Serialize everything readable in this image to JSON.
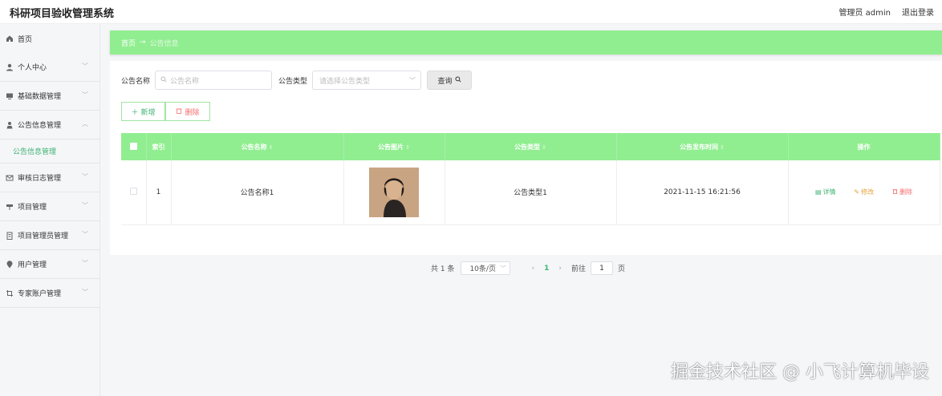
{
  "app": {
    "title": "科研项目验收管理系统"
  },
  "header": {
    "user": "管理员 admin",
    "logout": "退出登录"
  },
  "sidebar": {
    "items": [
      {
        "label": "首页",
        "icon": "home-icon"
      },
      {
        "label": "个人中心",
        "icon": "user-icon"
      },
      {
        "label": "基础数据管理",
        "icon": "monitor-icon"
      },
      {
        "label": "公告信息管理",
        "icon": "person-icon",
        "expanded": true,
        "children": [
          {
            "label": "公告信息管理"
          }
        ]
      },
      {
        "label": "审核日志管理",
        "icon": "message-icon"
      },
      {
        "label": "项目管理",
        "icon": "briefcase-icon"
      },
      {
        "label": "项目管理员管理",
        "icon": "office-icon"
      },
      {
        "label": "用户管理",
        "icon": "location-icon"
      },
      {
        "label": "专家账户管理",
        "icon": "crop-icon"
      }
    ]
  },
  "breadcrumb": {
    "home": "首页",
    "arrow": "→",
    "current": "公告信息"
  },
  "search": {
    "name_label": "公告名称",
    "name_placeholder": "公告名称",
    "type_label": "公告类型",
    "type_placeholder": "请选择公告类型",
    "query_button": "查询"
  },
  "actions": {
    "add": "新增",
    "delete": "删除"
  },
  "table": {
    "headers": [
      "索引",
      "公告名称",
      "公告图片",
      "公告类型",
      "公告发布时间",
      "操作"
    ],
    "rows": [
      {
        "index": "1",
        "name": "公告名称1",
        "type": "公告类型1",
        "time": "2021-11-15 16:21:56"
      }
    ],
    "ops": {
      "detail": "详情",
      "edit": "修改",
      "remove": "删除"
    }
  },
  "pagination": {
    "total": "共 1 条",
    "page_size": "10条/页",
    "current_page": "1",
    "goto_label": "前往",
    "goto_value": "1",
    "page_unit": "页"
  },
  "watermark": "掘金技术社区 @ 小飞计算机毕设",
  "colors": {
    "accent": "#90ee90",
    "accent_text": "#3cb371",
    "danger": "#f56c6c",
    "warning": "#e6a23c"
  }
}
